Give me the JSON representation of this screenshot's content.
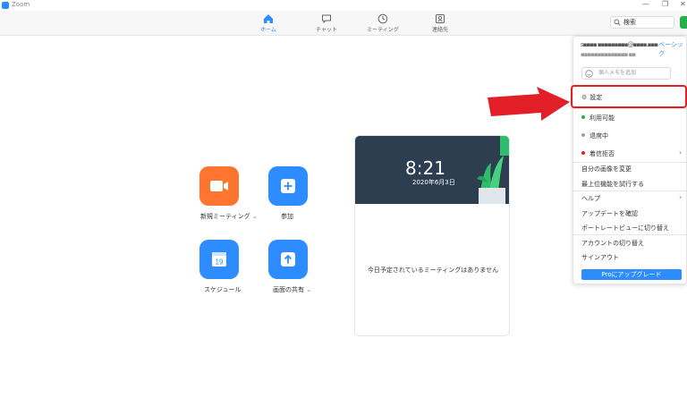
{
  "window": {
    "title": "Zoom",
    "minimize": "—",
    "maximize": "❐",
    "close": "✕"
  },
  "nav": {
    "home": "ホーム",
    "chat": "チャット",
    "meetings": "ミーティング",
    "contacts": "連絡先"
  },
  "search": {
    "label": "検索"
  },
  "actions": {
    "new_meeting": "新規ミーティング",
    "join": "参加",
    "schedule": "スケジュール",
    "share_screen": "画面の共有",
    "calendar_day": "19"
  },
  "calendar": {
    "time": "8:21",
    "date": "2020年6月3日",
    "no_meetings": "今日予定されているミーティングはありません"
  },
  "profile_menu": {
    "name": "s▪▪▪▪ ▪▪▪▪▪▪▪▪▪@▪▪▪▪.▪▪▪",
    "email": "▪▪▪▪▪▪▪▪▪▪▪▪▪▪ ▪▪",
    "plan": "ベーシック",
    "memo_placeholder": "個人メモを追加",
    "settings": "設定",
    "available": "利用可能",
    "away": "退席中",
    "dnd": "着信拒否",
    "change_picture": "自分の画像を変更",
    "try_top_features": "最上位機能を試行する",
    "help": "ヘルプ",
    "check_updates": "アップデートを確認",
    "portrait_view": "ポートレートビューに切り替え",
    "switch_account": "アカウントの切り替え",
    "sign_out": "サインアウト",
    "upgrade": "Proにアップグレード"
  },
  "colors": {
    "accent": "#2d8cff",
    "orange": "#ff742e",
    "available": "#26b048",
    "away": "#9aa0a6",
    "dnd": "#e21e26",
    "highlight": "#e21e26"
  }
}
